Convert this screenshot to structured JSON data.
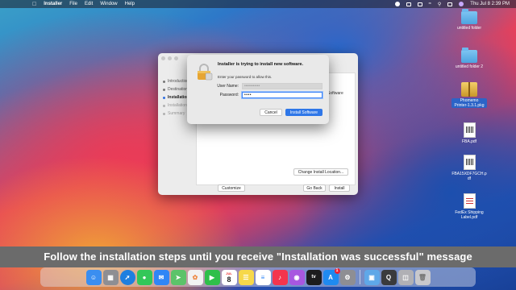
{
  "menubar": {
    "app_name": "Installer",
    "menus": [
      "File",
      "Edit",
      "Window",
      "Help"
    ],
    "clock": "Thu Jul 8  2:39 PM"
  },
  "desktop_icons": [
    {
      "label": "untitled folder",
      "kind": "folder",
      "selected": false
    },
    {
      "label": "untitled folder 2",
      "kind": "folder",
      "selected": false
    },
    {
      "label": "Phomemo Printer-1.3.1.pkg",
      "kind": "pkg",
      "selected": true
    },
    {
      "label": "FBA.pdf",
      "kind": "pdf",
      "selected": false
    },
    {
      "label": "FBA15XDF7GCH.pdf",
      "kind": "pdf",
      "selected": false
    },
    {
      "label": "FedEx Shipping Label.pdf",
      "kind": "pdf",
      "selected": false
    }
  ],
  "installer": {
    "steps": [
      {
        "label": "Introduction",
        "state": "done"
      },
      {
        "label": "Destination Select",
        "state": "done"
      },
      {
        "label": "Installation Type",
        "state": "active"
      },
      {
        "label": "Installation",
        "state": "pending"
      },
      {
        "label": "Summary",
        "state": "pending"
      }
    ],
    "content_text": "Software",
    "change_location_label": "Change Install Location...",
    "customize_label": "Customize",
    "go_back_label": "Go Back",
    "install_label": "Install"
  },
  "auth_dialog": {
    "title": "Installer is trying to install new software.",
    "subtitle": "Enter your password to allow this.",
    "username_label": "User Name:",
    "username_value": "•••••••••••",
    "password_label": "Password:",
    "password_value": "••••",
    "cancel_label": "Cancel",
    "install_software_label": "Install Software"
  },
  "caption": "Follow the installation steps until you receive \"Installation was successful\" message",
  "dock": {
    "apps": [
      {
        "name": "finder-icon",
        "color": "#3a8ef0"
      },
      {
        "name": "launchpad-icon",
        "color": "#8e8e93"
      },
      {
        "name": "safari-icon",
        "color": "#1f7fe0"
      },
      {
        "name": "messages-icon",
        "color": "#33c759"
      },
      {
        "name": "mail-icon",
        "color": "#2f86f6"
      },
      {
        "name": "maps-icon",
        "color": "#5cc36a"
      },
      {
        "name": "photos-icon",
        "color": "#f2f2f2"
      },
      {
        "name": "facetime-icon",
        "color": "#2fbf4a"
      },
      {
        "name": "calendar-icon",
        "color": "#ffffff"
      },
      {
        "name": "notes-icon",
        "color": "#f6d84a"
      },
      {
        "name": "reminders-icon",
        "color": "#ffffff"
      },
      {
        "name": "music-icon",
        "color": "#f4354d"
      },
      {
        "name": "podcasts-icon",
        "color": "#a857e0"
      },
      {
        "name": "tv-icon",
        "color": "#1c1c1e"
      },
      {
        "name": "app-store-icon",
        "color": "#1f8af0"
      },
      {
        "name": "system-preferences-icon",
        "color": "#8e8e93"
      },
      {
        "name": "preview-icon",
        "color": "#5fa8e8"
      },
      {
        "name": "quicktime-icon",
        "color": "#3a3a3c"
      },
      {
        "name": "installer-icon",
        "color": "#b0b0b5"
      },
      {
        "name": "trash-icon",
        "color": "#c8c8cc"
      }
    ],
    "calendar_month": "JUL",
    "calendar_day": "8",
    "tv_label": "tv",
    "app_store_badge": "1"
  }
}
